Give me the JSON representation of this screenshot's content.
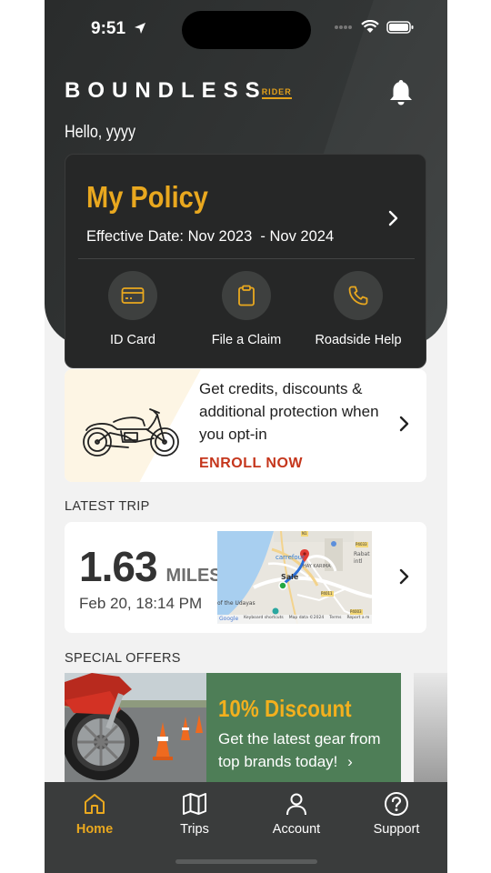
{
  "status_bar": {
    "time": "9:51"
  },
  "header": {
    "brand_main": "BOUNDLESS",
    "brand_sub": "RIDER",
    "greeting": "Hello, yyyy"
  },
  "policy": {
    "title": "My Policy",
    "effective_label": "Effective Date:",
    "effective_dates": "Nov 2023  - Nov 2024",
    "actions": [
      {
        "label": "ID Card",
        "icon": "id-card-icon"
      },
      {
        "label": "File a Claim",
        "icon": "clipboard-icon"
      },
      {
        "label": "Roadside Help",
        "icon": "phone-icon"
      }
    ]
  },
  "enroll": {
    "text": "Get credits, discounts & additional protection when you opt-in",
    "link": "ENROLL NOW"
  },
  "latest_trip": {
    "section_label": "LATEST TRIP",
    "miles_value": "1.63",
    "miles_unit": "MILES",
    "date": "Feb 20, 18:14 PM",
    "map": {
      "labels": [
        "carrefour",
        "HAY KARIMA",
        "Sale",
        "Rabat intl",
        "of the Udayas",
        "P4033",
        "P4011",
        "N1",
        "P4003"
      ],
      "footer": [
        "Google",
        "Keyboard shortcuts",
        "Map data ©2024",
        "Terms",
        "Report a m"
      ]
    }
  },
  "special_offers": {
    "section_label": "SPECIAL OFFERS",
    "offer_title": "10% Discount",
    "offer_text": "Get the latest gear from top brands today!",
    "offer_arrow": "›"
  },
  "tabs": [
    {
      "label": "Home",
      "icon": "home-icon",
      "active": true
    },
    {
      "label": "Trips",
      "icon": "map-icon",
      "active": false
    },
    {
      "label": "Account",
      "icon": "user-icon",
      "active": false
    },
    {
      "label": "Support",
      "icon": "help-icon",
      "active": false
    }
  ],
  "colors": {
    "accent": "#e9a81f",
    "enroll_red": "#c5361c",
    "offer_green": "#4e7e57",
    "dark_bg": "#262727"
  }
}
